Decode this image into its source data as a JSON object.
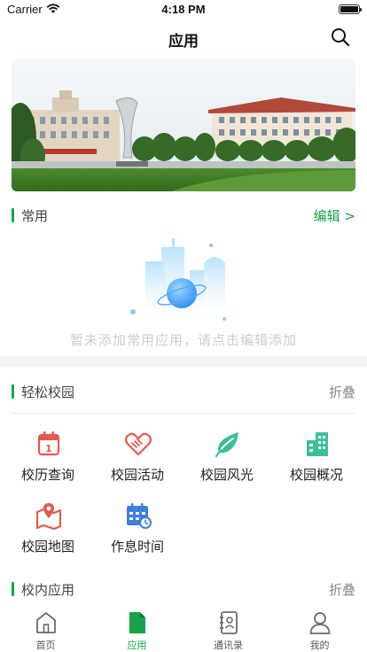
{
  "status_bar": {
    "carrier": "Carrier",
    "time": "4:18 PM"
  },
  "header": {
    "title": "应用"
  },
  "favorites": {
    "title": "常用",
    "edit_label": "编辑 >",
    "empty_text": "暂未添加常用应用，请点击编辑添加"
  },
  "campus": {
    "title": "轻松校园",
    "collapse_label": "折叠",
    "items": [
      {
        "label": "校历查询",
        "icon": "calendar-icon"
      },
      {
        "label": "校园活动",
        "icon": "handshake-icon"
      },
      {
        "label": "校园风光",
        "icon": "leaf-icon"
      },
      {
        "label": "校园概况",
        "icon": "buildings-icon"
      },
      {
        "label": "校园地图",
        "icon": "map-pin-icon"
      },
      {
        "label": "作息时间",
        "icon": "schedule-icon"
      }
    ]
  },
  "internal": {
    "title": "校内应用",
    "collapse_label": "折叠"
  },
  "tabs": [
    {
      "label": "首页",
      "icon": "home-icon",
      "active": false
    },
    {
      "label": "应用",
      "icon": "document-icon",
      "active": true
    },
    {
      "label": "通讯录",
      "icon": "contacts-icon",
      "active": false
    },
    {
      "label": "我的",
      "icon": "person-icon",
      "active": false
    }
  ],
  "colors": {
    "accent": "#16a34a",
    "banner_sky": "#eaf2f6"
  }
}
